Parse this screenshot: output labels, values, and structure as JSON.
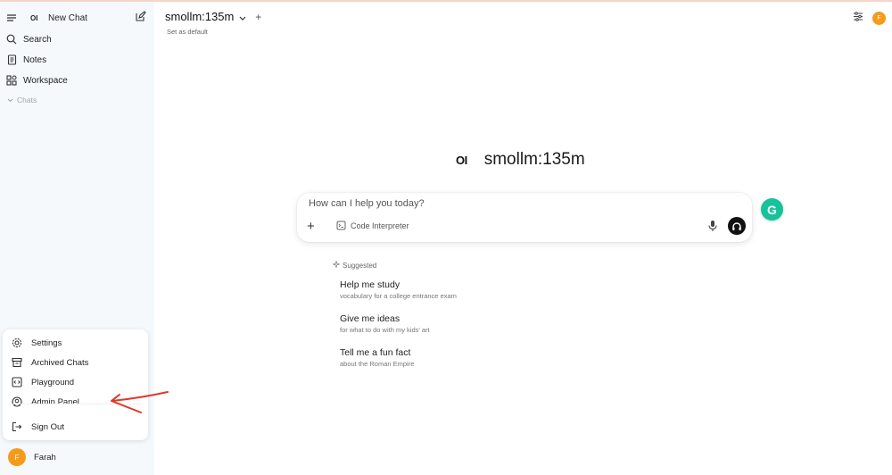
{
  "sidebar": {
    "new_chat": "New Chat",
    "items": [
      {
        "label": "Search",
        "icon": "search-icon"
      },
      {
        "label": "Notes",
        "icon": "notes-icon"
      },
      {
        "label": "Workspace",
        "icon": "workspace-icon"
      }
    ],
    "chats_header": "Chats"
  },
  "user_menu": {
    "items": [
      {
        "label": "Settings",
        "icon": "gear-icon"
      },
      {
        "label": "Archived Chats",
        "icon": "archive-icon"
      },
      {
        "label": "Playground",
        "icon": "code-icon"
      },
      {
        "label": "Admin Panel",
        "icon": "user-circle-icon"
      },
      {
        "label": "Sign Out",
        "icon": "sign-out-icon"
      }
    ]
  },
  "user": {
    "name": "Farah",
    "initial": "F"
  },
  "header": {
    "model": "smollm:135m",
    "set_default": "Set as default"
  },
  "hero": {
    "logo": "OI",
    "title": "smollm:135m"
  },
  "composer": {
    "placeholder": "How can I help you today?",
    "tool": "Code Interpreter"
  },
  "suggested": {
    "header": "Suggested",
    "items": [
      {
        "title": "Help me study",
        "subtitle": "vocabulary for a college entrance exam"
      },
      {
        "title": "Give me ideas",
        "subtitle": "for what to do with my kids' art"
      },
      {
        "title": "Tell me a fun fact",
        "subtitle": "about the Roman Empire"
      }
    ]
  },
  "colors": {
    "accent_avatar": "#f59b1a",
    "annotation_arrow": "#e0382b",
    "grammarly": "#15c39a"
  }
}
